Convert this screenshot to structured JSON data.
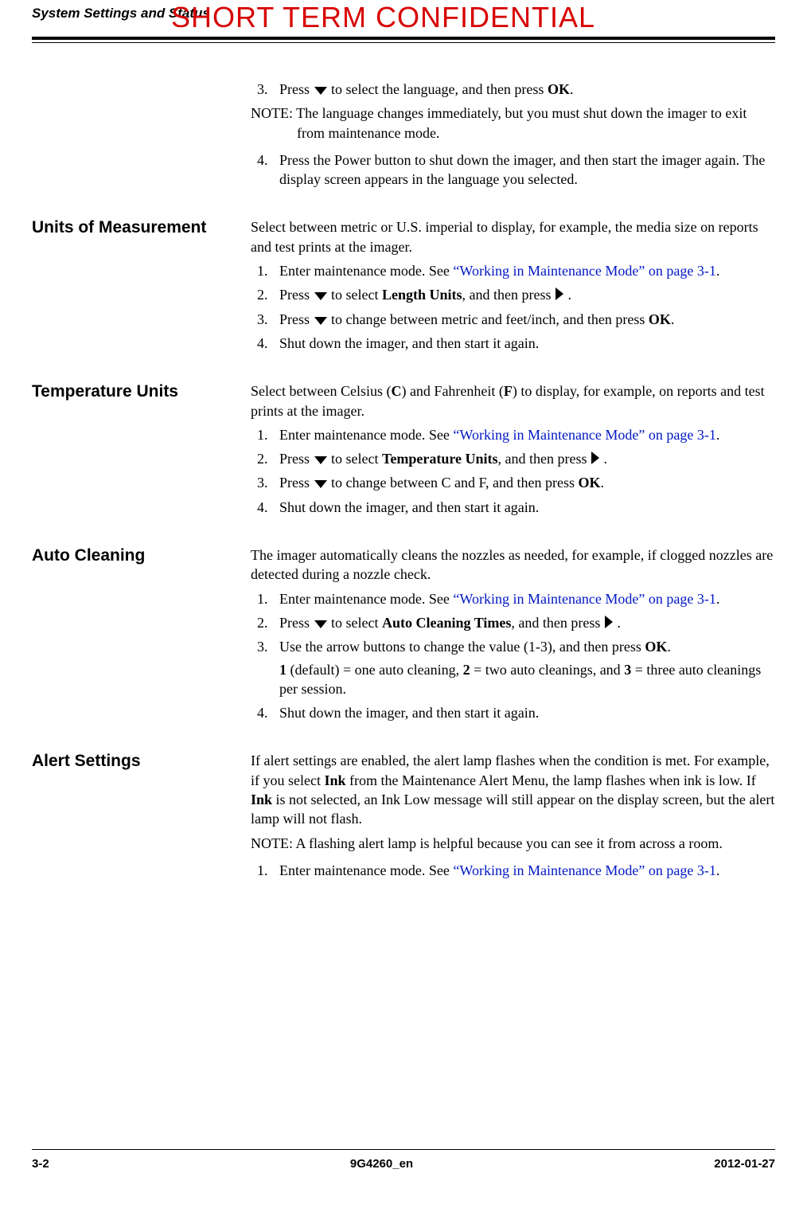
{
  "header": {
    "running_head": "System Settings and Status",
    "watermark": "SHORT TERM CONFIDENTIAL"
  },
  "intro": {
    "step3_a": "Press ",
    "step3_b": " to select the language, and then press ",
    "step3_ok": "OK",
    "step3_c": ".",
    "note": "NOTE: The language changes immediately, but you must shut down the imager to exit from maintenance mode.",
    "step4": "Press the Power button to shut down the imager, and then start the imager again. The display screen appears in the language you selected."
  },
  "units": {
    "heading": "Units of Measurement",
    "intro": "Select between metric or U.S. imperial to display, for example, the media size on reports and test prints at the imager.",
    "step1_a": "Enter maintenance mode. See ",
    "step1_link": "“Working in Maintenance Mode” on page 3-1",
    "step1_b": ".",
    "step2_a": "Press ",
    "step2_b": " to select ",
    "step2_bold": "Length Units",
    "step2_c": ", and then press ",
    "step2_d": ".",
    "step3_a": "Press ",
    "step3_b": " to change between metric and feet/inch, and then press ",
    "step3_ok": "OK",
    "step3_c": ".",
    "step4": "Shut down the imager, and then start it again."
  },
  "temp": {
    "heading": "Temperature Units",
    "intro_a": "Select between Celsius (",
    "intro_c": "C",
    "intro_b": ") and Fahrenheit (",
    "intro_f": "F",
    "intro_c2": ") to display, for example, on reports and test prints at the imager.",
    "step1_a": "Enter maintenance mode. See ",
    "step1_link": "“Working in Maintenance Mode” on page 3-1",
    "step1_b": ".",
    "step2_a": "Press ",
    "step2_b": " to select ",
    "step2_bold": "Temperature Units",
    "step2_c": ", and then press ",
    "step2_d": ".",
    "step3_a": "Press ",
    "step3_b": " to change between C and F, and then press ",
    "step3_ok": "OK",
    "step3_c": ".",
    "step4": "Shut down the imager, and then start it again."
  },
  "auto": {
    "heading": "Auto Cleaning",
    "intro": "The imager automatically cleans the nozzles as needed, for example, if clogged nozzles are detected during a nozzle check.",
    "step1_a": "Enter maintenance mode. See ",
    "step1_link": "“Working in Maintenance Mode” on page 3-1",
    "step1_b": ".",
    "step2_a": "Press ",
    "step2_b": " to select ",
    "step2_bold": "Auto Cleaning Times",
    "step2_c": ", and then press ",
    "step2_d": ".",
    "step3_a": "Use the arrow buttons to change the value (1-3), and then press ",
    "step3_ok": "OK",
    "step3_b": ".",
    "step3_sub_1": "1",
    "step3_sub_a": " (default) = one auto cleaning, ",
    "step3_sub_2": "2",
    "step3_sub_b": " = two auto cleanings, and ",
    "step3_sub_3": "3",
    "step3_sub_c": " = three auto cleanings per session.",
    "step4": "Shut down the imager, and then start it again."
  },
  "alert": {
    "heading": "Alert Settings",
    "intro_a": "If alert settings are enabled, the alert lamp flashes when the condition is met. For example, if you select ",
    "intro_ink1": "Ink",
    "intro_b": " from the Maintenance Alert Menu, the lamp flashes when ink is low. If ",
    "intro_ink2": "Ink",
    "intro_c": " is not selected, an Ink Low message will still appear on the display screen, but the alert lamp will not flash.",
    "note": "NOTE: A flashing alert lamp is helpful because you can see it from across a room.",
    "step1_a": "Enter maintenance mode. See ",
    "step1_link": "“Working in Maintenance Mode” on page 3-1",
    "step1_b": "."
  },
  "footer": {
    "page": "3-2",
    "docid": "9G4260_en",
    "date": "2012-01-27"
  },
  "nums": {
    "n1": "1.",
    "n2": "2.",
    "n3": "3.",
    "n4": "4."
  }
}
